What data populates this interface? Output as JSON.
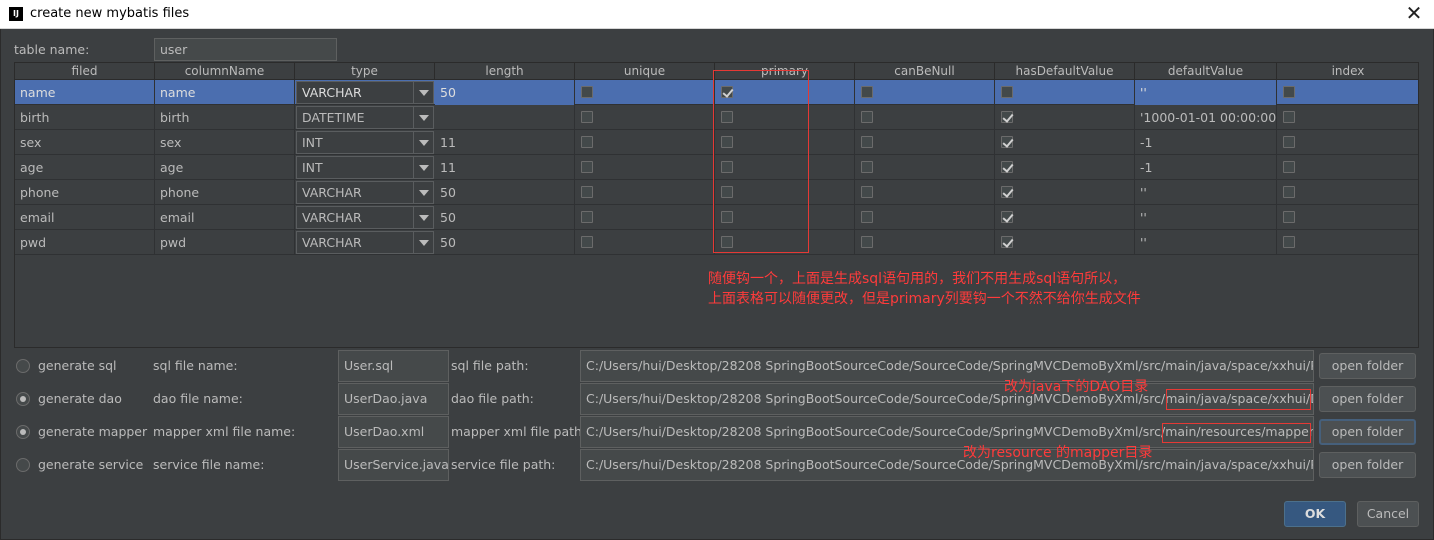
{
  "window": {
    "title": "create new mybatis files",
    "close_glyph": "✕",
    "app_icon": "IJ"
  },
  "table_name": {
    "label": "table name:",
    "value": "user"
  },
  "columns": [
    "filed",
    "columnName",
    "type",
    "length",
    "unique",
    "primary",
    "canBeNull",
    "hasDefaultValue",
    "defaultValue",
    "index"
  ],
  "rows": [
    {
      "filed": "name",
      "columnName": "name",
      "type": "VARCHAR",
      "length": "50",
      "unique": false,
      "primary": true,
      "canBeNull": false,
      "hasDefaultValue": false,
      "defaultValue": "''",
      "index": false
    },
    {
      "filed": "birth",
      "columnName": "birth",
      "type": "DATETIME",
      "length": "",
      "unique": false,
      "primary": false,
      "canBeNull": false,
      "hasDefaultValue": true,
      "defaultValue": "'1000-01-01 00:00:00'",
      "index": false
    },
    {
      "filed": "sex",
      "columnName": "sex",
      "type": "INT",
      "length": "11",
      "unique": false,
      "primary": false,
      "canBeNull": false,
      "hasDefaultValue": true,
      "defaultValue": "-1",
      "index": false
    },
    {
      "filed": "age",
      "columnName": "age",
      "type": "INT",
      "length": "11",
      "unique": false,
      "primary": false,
      "canBeNull": false,
      "hasDefaultValue": true,
      "defaultValue": "-1",
      "index": false
    },
    {
      "filed": "phone",
      "columnName": "phone",
      "type": "VARCHAR",
      "length": "50",
      "unique": false,
      "primary": false,
      "canBeNull": false,
      "hasDefaultValue": true,
      "defaultValue": "''",
      "index": false
    },
    {
      "filed": "email",
      "columnName": "email",
      "type": "VARCHAR",
      "length": "50",
      "unique": false,
      "primary": false,
      "canBeNull": false,
      "hasDefaultValue": true,
      "defaultValue": "''",
      "index": false
    },
    {
      "filed": "pwd",
      "columnName": "pwd",
      "type": "VARCHAR",
      "length": "50",
      "unique": false,
      "primary": false,
      "canBeNull": false,
      "hasDefaultValue": true,
      "defaultValue": "''",
      "index": false
    }
  ],
  "annotations": {
    "table_note_line1": "随便钩一个，上面是生成sql语句用的，我们不用生成sql语句所以，",
    "table_note_line2": "上面表格可以随便更改，但是primary列要钩一个不然不给你生成文件",
    "dao_note": "改为java下的DAO目录",
    "mapper_note": "改为resource 的mapper目录",
    "color": "#ff3b3b"
  },
  "generators": [
    {
      "key": "sql",
      "option": "generate sql",
      "checked": false,
      "name_label": "sql file name:",
      "name_value": "User.sql",
      "path_label": "sql file path:",
      "path_value": "C:/Users/hui/Desktop/28208 SpringBootSourceCode/SourceCode/SpringMVCDemoByXml/src/main/java/space/xxhui/POJO",
      "button": "open folder"
    },
    {
      "key": "dao",
      "option": "generate dao",
      "checked": true,
      "name_label": "dao file name:",
      "name_value": "UserDao.java",
      "path_label": "dao file path:",
      "path_value": "C:/Users/hui/Desktop/28208 SpringBootSourceCode/SourceCode/SpringMVCDemoByXml/src/main/java/space/xxhui/DAO",
      "button": "open folder"
    },
    {
      "key": "mapper",
      "option": "generate mapper",
      "checked": true,
      "name_label": "mapper xml file name:",
      "name_value": "UserDao.xml",
      "path_label": "mapper xml file path:",
      "path_value": "C:/Users/hui/Desktop/28208 SpringBootSourceCode/SourceCode/SpringMVCDemoByXml/src/main/resources/mapper",
      "button": "open folder"
    },
    {
      "key": "service",
      "option": "generate service",
      "checked": false,
      "name_label": "service file name:",
      "name_value": "UserService.java",
      "path_label": "service file path:",
      "path_value": "C:/Users/hui/Desktop/28208 SpringBootSourceCode/SourceCode/SpringMVCDemoByXml/src/main/java/space/xxhui/POJO",
      "button": "open folder"
    }
  ],
  "footer": {
    "ok": "OK",
    "cancel": "Cancel"
  }
}
